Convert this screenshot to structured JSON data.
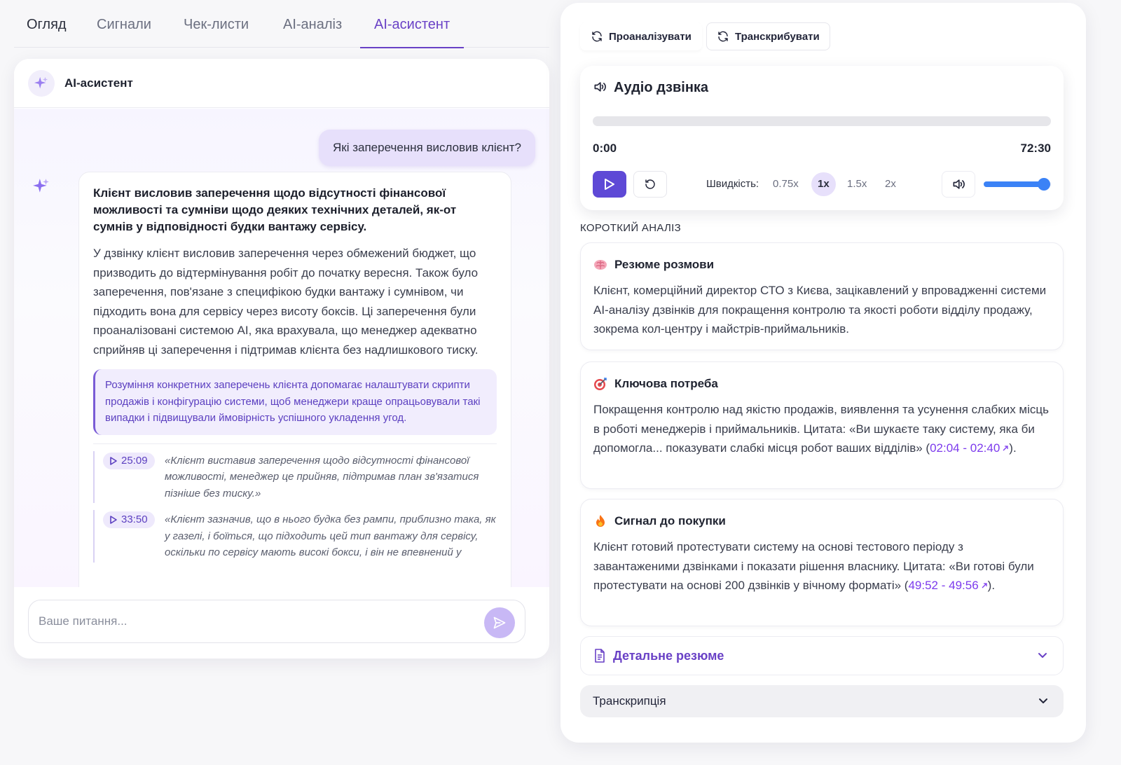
{
  "tabs": [
    {
      "label": "Огляд"
    },
    {
      "label": "Сигнали"
    },
    {
      "label": "Чек-листи"
    },
    {
      "label": "AI-аналіз"
    },
    {
      "label": "AI-асистент"
    }
  ],
  "chat": {
    "title": "AI-асистент",
    "user_message": "Які заперечення висловив клієнт?",
    "ai": {
      "lead": "Клієнт висловив заперечення щодо відсутності фінансової можливості та сумніви щодо деяких технічних деталей, як-от сумнів у відповідності будки вантажу сервісу.",
      "text": "У дзвінку клієнт висловив заперечення через обмежений бюджет, що призводить до відтермінування робіт до початку вересня. Також було заперечення, пов'язане з специфікою будки вантажу і сумнівом, чи підходить вона для сервісу через висоту боксів. Ці заперечення були проаналізовані системою AI, яка врахувала, що менеджер адекватно сприйняв ці заперечення і підтримав клієнта без надлишкового тиску.",
      "insight": "Розуміння конкретних заперечень клієнта допомагає налаштувати скрипти продажів і конфігурацію системи, щоб менеджери краще опрацьовували такі випадки і підвищували ймовірність успішного укладення угод.",
      "quotes": [
        {
          "time": "25:09",
          "text": "«Клієнт виставив заперечення щодо відсутності фінансової можливості, менеджер це прийняв, підтримав план зв'язатися пізніше без тиску.»"
        },
        {
          "time": "33:50",
          "text": "«Клієнт зазначив, що в нього будка без рампи, приблизно така, як у газелі, і боїться, що підходить цей тип вантажу для сервісу, оскільки по сервісу мають високі бокси, і він не впевнений у"
        }
      ]
    },
    "input_placeholder": "Ваше питання..."
  },
  "actions": {
    "analyze": "Проаналізувати",
    "transcribe": "Транскрибувати"
  },
  "audio": {
    "title": "Аудіо дзвінка",
    "current_time": "0:00",
    "total_time": "72:30",
    "progress": 0,
    "speed_label": "Швидкість:",
    "speeds": [
      "0.75x",
      "1x",
      "1.5x",
      "2x"
    ],
    "active_speed": "1x",
    "volume": 0.9
  },
  "analysis": {
    "section_label": "КОРОТКИЙ АНАЛІЗ",
    "summary": {
      "icon": "brain-icon",
      "title": "Резюме розмови",
      "text": "Клієнт, комерційний директор СТО з Києва, зацікавлений у впровадженні системи AI-аналізу дзвінків для покращення контролю та якості роботи відділу продажу, зокрема кол-центру і майстрів-приймальників."
    },
    "need": {
      "icon": "target-icon",
      "title": "Ключова потреба",
      "text": "Покращення контролю над якістю продажів, виявлення та усунення слабких місць в роботі менеджерів і приймальників. Цитата: «Ви шукаєте таку систему, яка би допомогла... показувати слабкі місця робот ваших відділів» (",
      "link": "02:04 - 02:40",
      "after": ")."
    },
    "signal": {
      "icon": "fire-icon",
      "title": "Сигнал до покупки",
      "text": "Клієнт готовий протестувати систему на основі тестового періоду з завантаженими дзвінками і показати рішення власнику. Цитата: «Ви готові були протестувати на основі 200 дзвінків у вічному форматі» (",
      "link": "49:52 - 49:56",
      "after": ")."
    },
    "detail_label": "Детальне резюме",
    "transcript_label": "Транскрипція"
  }
}
